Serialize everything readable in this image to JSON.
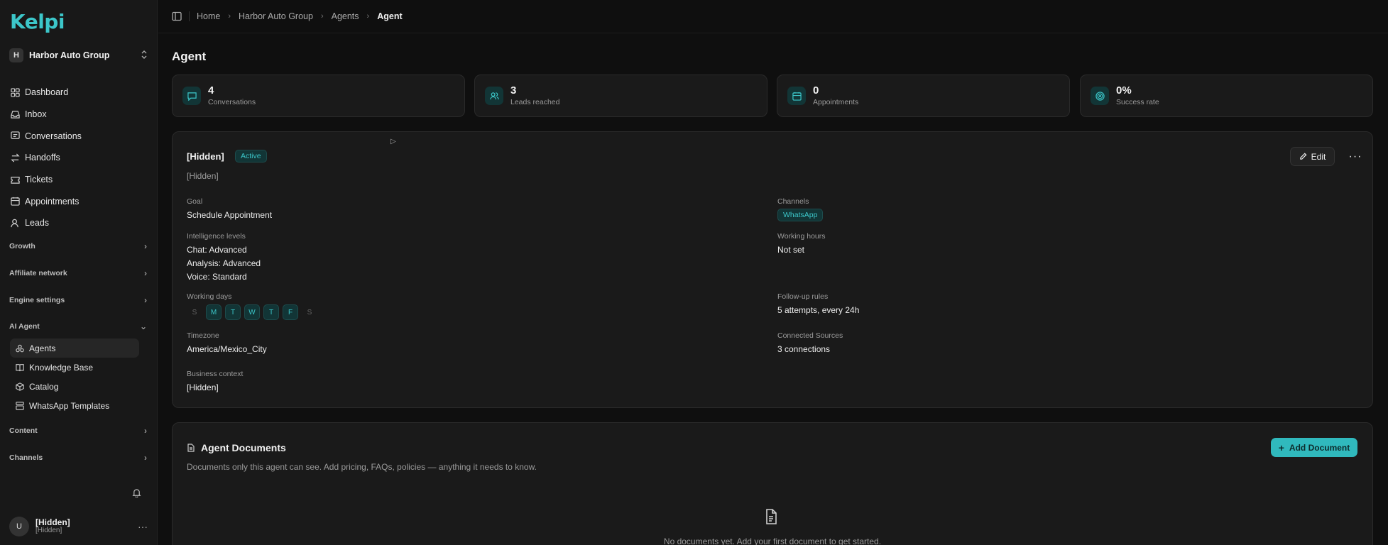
{
  "app": {
    "logo": "Kelpi"
  },
  "org": {
    "initial": "H",
    "name": "Harbor Auto Group"
  },
  "nav": [
    {
      "label": "Dashboard",
      "icon": "dashboard-icon"
    },
    {
      "label": "Inbox",
      "icon": "inbox-icon"
    },
    {
      "label": "Conversations",
      "icon": "conversations-icon"
    },
    {
      "label": "Handoffs",
      "icon": "handoffs-icon"
    },
    {
      "label": "Tickets",
      "icon": "tickets-icon"
    },
    {
      "label": "Appointments",
      "icon": "calendar-icon"
    },
    {
      "label": "Leads",
      "icon": "leads-icon"
    }
  ],
  "groups": {
    "growth": "Growth",
    "affiliate": "Affiliate network",
    "engine": "Engine settings",
    "ai_agent": "AI Agent",
    "content": "Content",
    "channels": "Channels"
  },
  "ai_agent_items": [
    {
      "label": "Agents",
      "icon": "agents-icon",
      "active": true
    },
    {
      "label": "Knowledge Base",
      "icon": "book-icon"
    },
    {
      "label": "Catalog",
      "icon": "box-icon"
    },
    {
      "label": "WhatsApp Templates",
      "icon": "templates-icon"
    }
  ],
  "user": {
    "initial": "U",
    "name": "[Hidden]",
    "sub": "[Hidden]"
  },
  "breadcrumb": [
    "Home",
    "Harbor Auto Group",
    "Agents",
    "Agent"
  ],
  "page_title": "Agent",
  "stats": [
    {
      "value": "4",
      "label": "Conversations",
      "icon": "chat-icon"
    },
    {
      "value": "3",
      "label": "Leads reached",
      "icon": "users-icon"
    },
    {
      "value": "0",
      "label": "Appointments",
      "icon": "calendar-icon"
    },
    {
      "value": "0%",
      "label": "Success rate",
      "icon": "target-icon"
    }
  ],
  "agent": {
    "name": "[Hidden]",
    "status": "Active",
    "description": "[Hidden]",
    "edit_label": "Edit",
    "goal_label": "Goal",
    "goal": "Schedule Appointment",
    "intelligence_label": "Intelligence levels",
    "intelligence": [
      "Chat: Advanced",
      "Analysis: Advanced",
      "Voice: Standard"
    ],
    "working_days_label": "Working days",
    "working_days": [
      {
        "d": "S",
        "on": false
      },
      {
        "d": "M",
        "on": true
      },
      {
        "d": "T",
        "on": true
      },
      {
        "d": "W",
        "on": true
      },
      {
        "d": "T",
        "on": true
      },
      {
        "d": "F",
        "on": true
      },
      {
        "d": "S",
        "on": false
      }
    ],
    "timezone_label": "Timezone",
    "timezone": "America/Mexico_City",
    "business_label": "Business context",
    "business": "[Hidden]",
    "channels_label": "Channels",
    "channels": [
      "WhatsApp"
    ],
    "hours_label": "Working hours",
    "hours": "Not set",
    "followup_label": "Follow-up rules",
    "followup": "5 attempts, every 24h",
    "sources_label": "Connected Sources",
    "sources": "3 connections"
  },
  "docs": {
    "title": "Agent Documents",
    "description": "Documents only this agent can see. Add pricing, FAQs, policies — anything it needs to know.",
    "add_label": "Add Document",
    "empty": "No documents yet. Add your first document to get started."
  },
  "colors": {
    "accent": "#3cc6c9",
    "accent_bg": "#123536",
    "button": "#30b9bd"
  }
}
